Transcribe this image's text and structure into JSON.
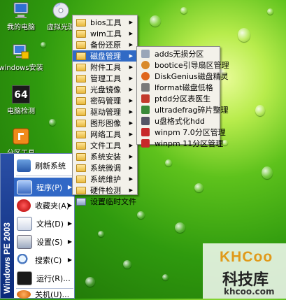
{
  "desktop": {
    "icons": [
      {
        "label": "我的电脑",
        "icon": "computer-icon"
      },
      {
        "label": "虚拟光驱",
        "icon": "virtual-cd-icon"
      },
      {
        "label": "windows安装",
        "icon": "windows-install-icon"
      },
      {
        "label": "电脑检测",
        "icon": "pc-check-icon"
      },
      {
        "label": "分区工具",
        "icon": "partition-tool-icon"
      }
    ],
    "pc_check_badge": "64"
  },
  "start_menu": {
    "sidebar_text": "Windows PE 2003",
    "items": [
      {
        "label": "刷新系统",
        "icon": "refresh-icon",
        "has_submenu": false
      },
      {
        "label": "程序(P)",
        "icon": "programs-icon",
        "has_submenu": true
      },
      {
        "label": "收藏夹(A)",
        "icon": "favorites-icon",
        "has_submenu": true
      },
      {
        "label": "文档(D)",
        "icon": "documents-icon",
        "has_submenu": true
      },
      {
        "label": "设置(S)",
        "icon": "settings-icon",
        "has_submenu": true
      },
      {
        "label": "搜索(C)",
        "icon": "search-icon",
        "has_submenu": true
      },
      {
        "label": "运行(R)...",
        "icon": "run-icon",
        "has_submenu": false
      },
      {
        "label": "关机(U)...",
        "icon": "shutdown-icon",
        "has_submenu": false
      }
    ]
  },
  "programs_menu": {
    "items": [
      {
        "label": "bios工具"
      },
      {
        "label": "wim工具"
      },
      {
        "label": "备份还原"
      },
      {
        "label": "磁盘管理"
      },
      {
        "label": "附件工具"
      },
      {
        "label": "管理工具"
      },
      {
        "label": "光盘镜像"
      },
      {
        "label": "密码管理"
      },
      {
        "label": "驱动管理"
      },
      {
        "label": "图形图像"
      },
      {
        "label": "网络工具"
      },
      {
        "label": "文件工具"
      },
      {
        "label": "系统安装"
      },
      {
        "label": "系统微调"
      },
      {
        "label": "系统维护"
      },
      {
        "label": "硬件检测"
      },
      {
        "label": "设置临时文件"
      }
    ]
  },
  "disk_menu": {
    "items": [
      {
        "label": "adds无损分区",
        "color": "#9aa6b8"
      },
      {
        "label": "bootice引导扇区管理",
        "color": "#d98a2b"
      },
      {
        "label": "DiskGenius磁盘精灵",
        "color": "#e0661c"
      },
      {
        "label": "lformat磁盘低格",
        "color": "#7a7a7a"
      },
      {
        "label": "ptdd分区表医生",
        "color": "#c33a2c"
      },
      {
        "label": "ultradefrag碎片整理",
        "color": "#3a8a3a"
      },
      {
        "label": "u盘格式化hdd",
        "color": "#555566"
      },
      {
        "label": "winpm 7.0分区管理",
        "color": "#c8282a"
      },
      {
        "label": "winpm 11分区管理",
        "color": "#c8282a"
      }
    ]
  },
  "watermark": {
    "brand": "KHCoo",
    "title": "科技库",
    "url": "khcoo.com"
  }
}
